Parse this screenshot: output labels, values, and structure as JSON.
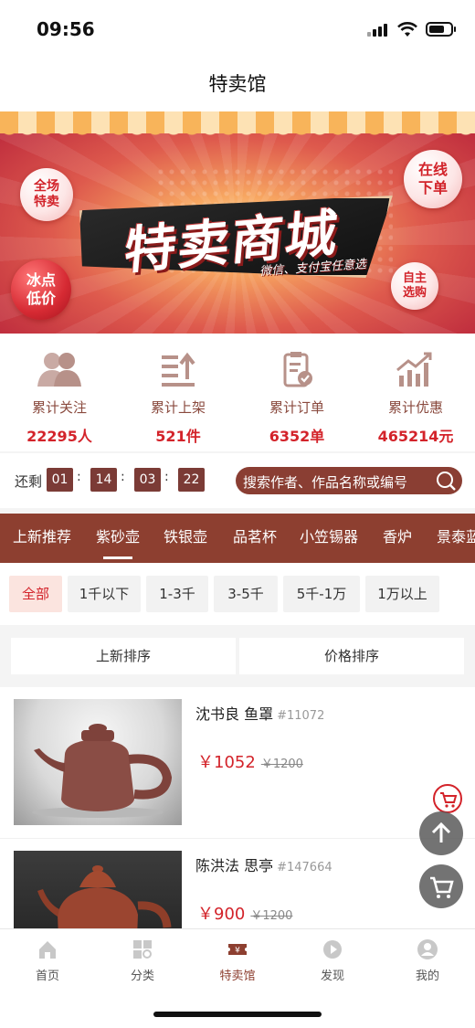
{
  "status_bar": {
    "time": "09:56"
  },
  "nav": {
    "title": "特卖馆"
  },
  "banner": {
    "headline": "特卖商城",
    "subtitle": "微信、支付宝任意选",
    "badges": [
      "全场\n特卖",
      "冰点\n低价",
      "在线\n下单",
      "自主\n选购"
    ]
  },
  "stats": [
    {
      "label": "累计关注",
      "value": "22295人",
      "icon": "people-icon"
    },
    {
      "label": "累计上架",
      "value": "521件",
      "icon": "shelf-upload-icon"
    },
    {
      "label": "累计订单",
      "value": "6352单",
      "icon": "clipboard-check-icon"
    },
    {
      "label": "累计优惠",
      "value": "465214元",
      "icon": "growth-chart-icon"
    }
  ],
  "countdown": {
    "label": "还剩",
    "days": "01",
    "hours": "14",
    "minutes": "03",
    "seconds": "22"
  },
  "search": {
    "placeholder": "搜索作者、作品名称或编号"
  },
  "categories": {
    "items": [
      "上新推荐",
      "紫砂壶",
      "铁银壶",
      "品茗杯",
      "小笠锡器",
      "香炉",
      "景泰蓝"
    ],
    "active": "紫砂壶"
  },
  "price_filters": {
    "items": [
      "全部",
      "1千以下",
      "1-3千",
      "3-5千",
      "5千-1万",
      "1万以上"
    ],
    "active": "全部"
  },
  "sort": {
    "new": "上新排序",
    "price": "价格排序"
  },
  "products": [
    {
      "title": "沈书良 鱼罩",
      "code": "#11072",
      "price": "￥1052",
      "original_price": "￥1200"
    },
    {
      "title": "陈洪法 思亭",
      "code": "#147664",
      "price": "￥900",
      "original_price": "￥1200"
    }
  ],
  "tabbar": {
    "items": [
      {
        "label": "首页",
        "icon": "home-icon"
      },
      {
        "label": "分类",
        "icon": "category-icon"
      },
      {
        "label": "特卖馆",
        "icon": "ticket-icon"
      },
      {
        "label": "发现",
        "icon": "play-icon"
      },
      {
        "label": "我的",
        "icon": "user-icon"
      }
    ],
    "active": "特卖馆"
  },
  "colors": {
    "brand": "#8d3f30",
    "price": "#d3232a",
    "timer_box": "#7b3b36"
  }
}
